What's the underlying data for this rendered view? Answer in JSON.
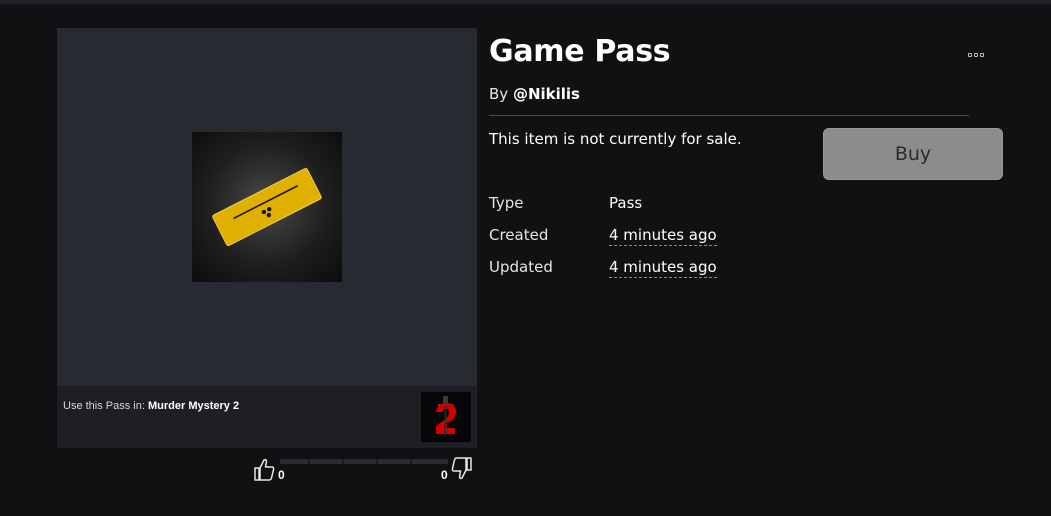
{
  "item": {
    "title": "Game Pass",
    "by_prefix": "By",
    "creator": "@Nikilis",
    "sale_status": "This item is not currently for sale.",
    "buy_label": "Buy"
  },
  "details": {
    "type_label": "Type",
    "type_value": "Pass",
    "created_label": "Created",
    "created_value": "4 minutes ago",
    "updated_label": "Updated",
    "updated_value": "4 minutes ago"
  },
  "usage": {
    "prefix": "Use this Pass in:",
    "game_name": "Murder Mystery 2"
  },
  "votes": {
    "up_count": "0",
    "down_count": "0",
    "up_fraction": 0
  },
  "icons": {
    "more": "more-options-icon",
    "thumbs_up": "thumbs-up-icon",
    "thumbs_down": "thumbs-down-icon"
  },
  "colors": {
    "background": "#111113",
    "panel": "#272a31",
    "buy_button": "#8c8c8c",
    "pass_gold": "#e0b000"
  }
}
